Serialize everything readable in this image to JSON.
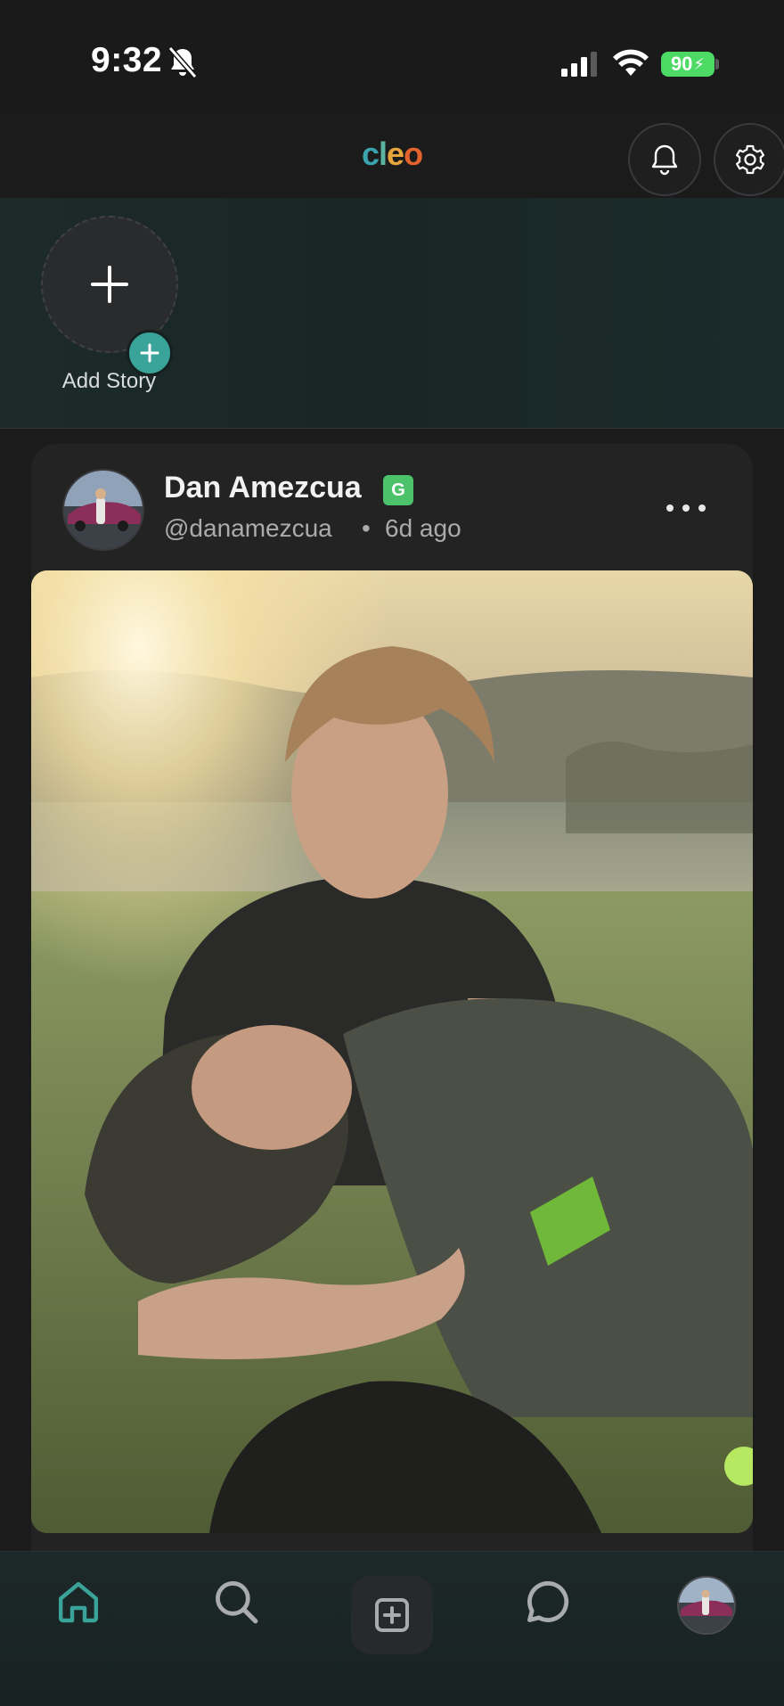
{
  "status_bar": {
    "time": "9:32",
    "battery": "90",
    "icons": [
      "bell-slash-icon",
      "cellular-signal-icon",
      "wifi-icon",
      "battery-charging-icon"
    ]
  },
  "header": {
    "logo": {
      "c": "c",
      "l": "l",
      "e": "e",
      "o": "o"
    },
    "buttons": [
      "notifications",
      "settings"
    ]
  },
  "stories": {
    "add_story_label": "Add Story"
  },
  "post": {
    "author_name": "Dan Amezcua",
    "author_badge": "G",
    "handle": "@danamezcua",
    "separator": "•",
    "posted_ago": "6d ago"
  },
  "tab_bar": {
    "items": [
      "home",
      "search",
      "create",
      "messages",
      "profile"
    ],
    "active": "home"
  },
  "colors": {
    "accent": "#3aa39a",
    "badge_green": "#4cc36a",
    "battery_green": "#4cd964",
    "background": "#1a1a1b"
  }
}
